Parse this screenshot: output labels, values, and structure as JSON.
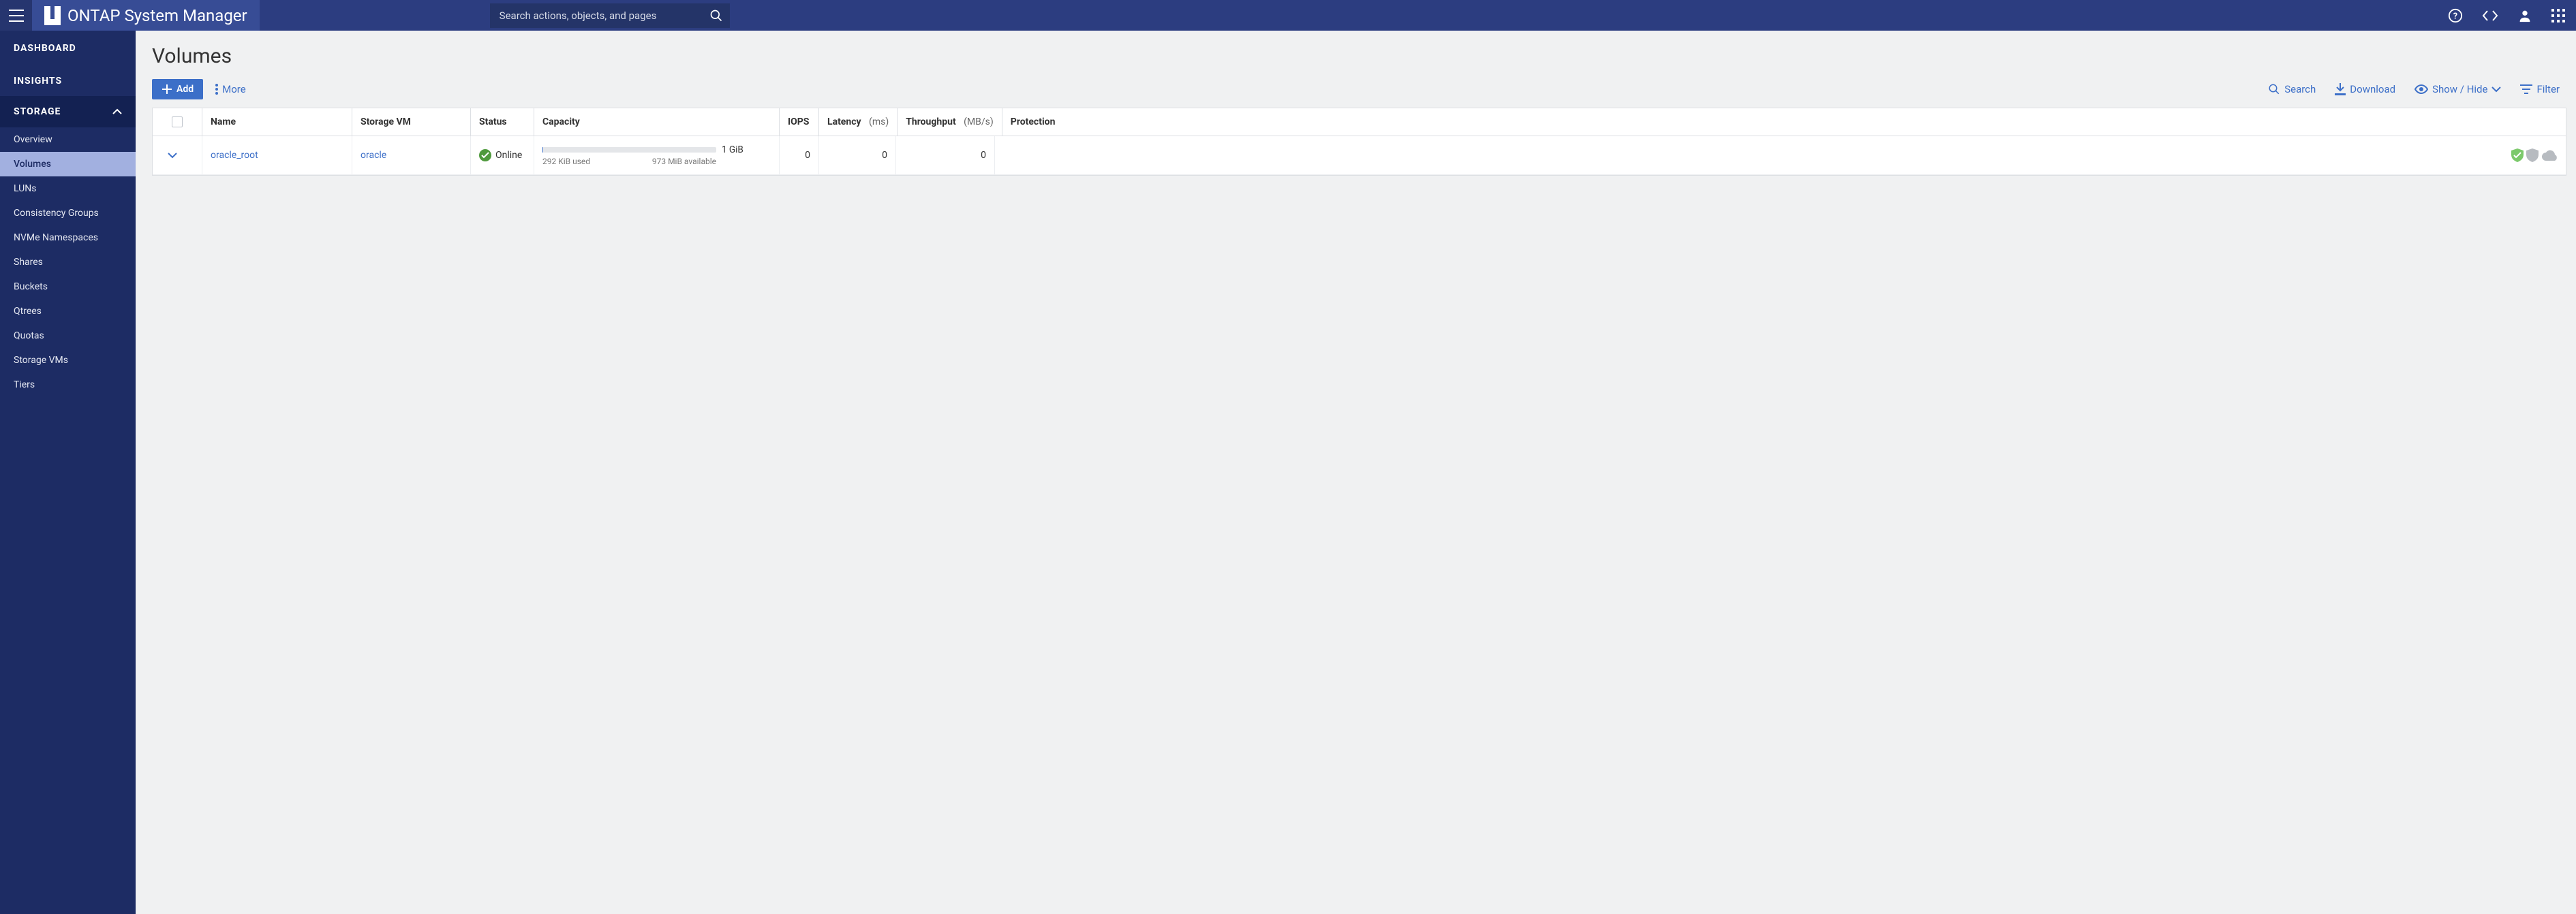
{
  "colors": {
    "brand_bg": "#2c3d80",
    "brand_accent": "#3c6fc8"
  },
  "topbar": {
    "app_name": "ONTAP System Manager",
    "search_placeholder": "Search actions, objects, and pages"
  },
  "nav": {
    "dashboard": "DASHBOARD",
    "insights": "INSIGHTS",
    "storage_hdr": "STORAGE",
    "storage_items": [
      "Overview",
      "Volumes",
      "LUNs",
      "Consistency Groups",
      "NVMe Namespaces",
      "Shares",
      "Buckets",
      "Qtrees",
      "Quotas",
      "Storage VMs",
      "Tiers"
    ],
    "active_index": 1
  },
  "page": {
    "title": "Volumes",
    "add_label": "Add",
    "more_label": "More",
    "search_label": "Search",
    "download_label": "Download",
    "showhide_label": "Show / Hide",
    "filter_label": "Filter"
  },
  "table": {
    "headers": {
      "name": "Name",
      "svm": "Storage VM",
      "status": "Status",
      "capacity": "Capacity",
      "iops": "IOPS",
      "latency": "Latency",
      "latency_unit": "(ms)",
      "throughput": "Throughput",
      "throughput_unit": "(MB/s)",
      "protection": "Protection"
    },
    "rows": [
      {
        "name": "oracle_root",
        "svm": "oracle",
        "status": "Online",
        "cap_total": "1 GiB",
        "cap_used": "292 KiB used",
        "cap_avail": "973 MiB available",
        "iops": "0",
        "latency": "0",
        "throughput": "0"
      }
    ]
  }
}
